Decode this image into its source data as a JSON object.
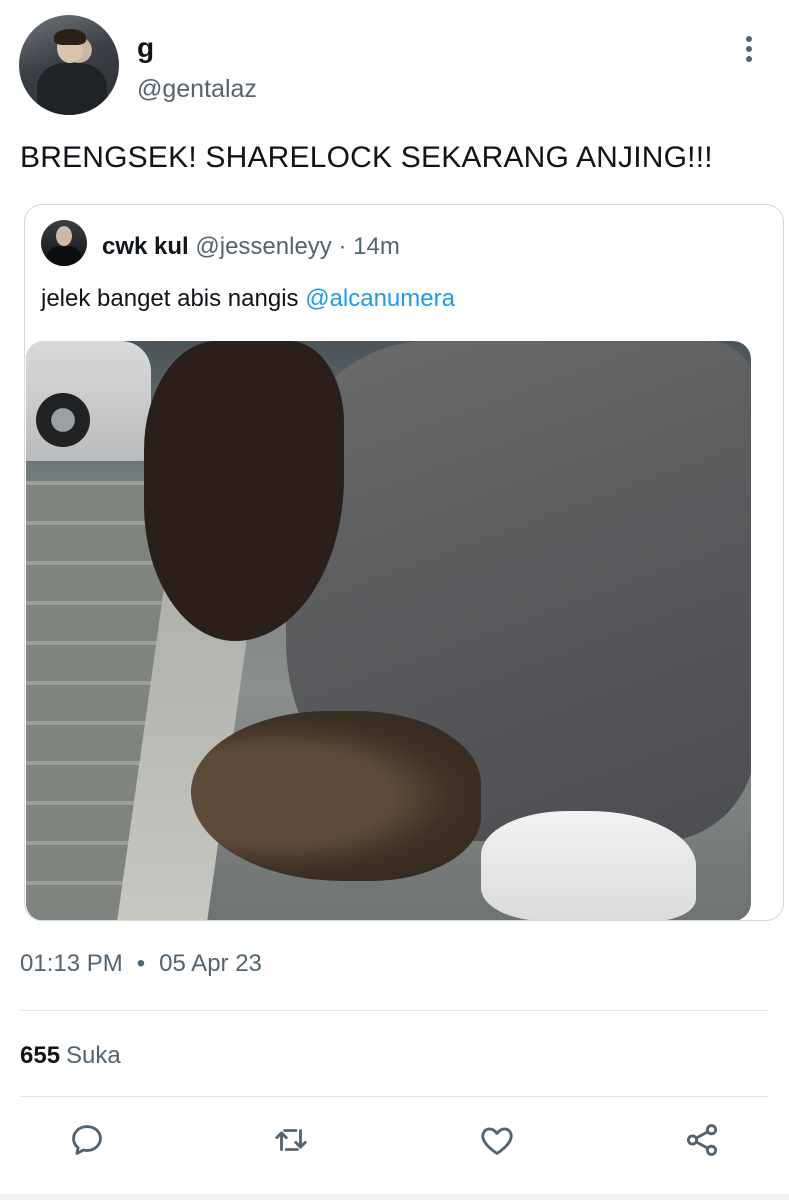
{
  "tweet": {
    "display_name": "g",
    "handle": "@gentalaz",
    "text": "BRENGSEK! SHARELOCK SEKARANG ANJING!!!",
    "time": "01:13 PM",
    "date": "05 Apr 23",
    "likes_count": "655",
    "likes_label": "Suka"
  },
  "quote": {
    "display_name": "cwk kul",
    "handle": "@jessenleyy",
    "separator": "·",
    "relative_time": "14m",
    "text": "jelek banget abis nangis ",
    "mention": "@alcanumera"
  },
  "icons": {
    "more": "more-vertical-icon",
    "reply": "reply-icon",
    "retweet": "retweet-icon",
    "like": "heart-icon",
    "share": "share-icon"
  },
  "colors": {
    "text": "#0f1419",
    "secondary": "#536471",
    "link": "#1d9bf0",
    "border": "#cfd9de"
  }
}
